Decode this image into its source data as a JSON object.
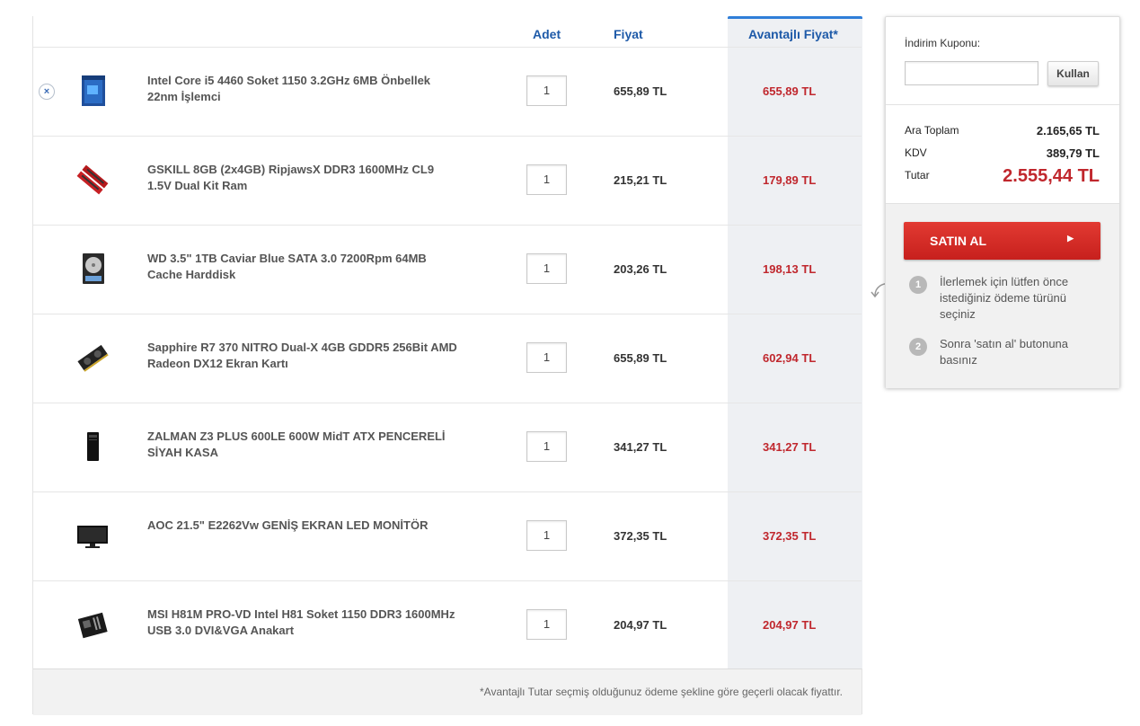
{
  "cart": {
    "headers": {
      "qty": "Adet",
      "price": "Fiyat",
      "adv_price": "Avantajlı Fiyat*"
    },
    "items": [
      {
        "name": "Intel Core i5 4460 Soket 1150 3.2GHz 6MB Önbellek 22nm İşlemci",
        "qty": "1",
        "price": "655,89 TL",
        "adv_price": "655,89 TL",
        "icon": "cpu-box-icon"
      },
      {
        "name": "GSKILL 8GB (2x4GB) RipjawsX DDR3 1600MHz CL9 1.5V Dual Kit Ram",
        "qty": "1",
        "price": "215,21 TL",
        "adv_price": "179,89 TL",
        "icon": "ram-icon"
      },
      {
        "name": "WD 3.5\" 1TB Caviar Blue SATA 3.0 7200Rpm 64MB Cache Harddisk",
        "qty": "1",
        "price": "203,26 TL",
        "adv_price": "198,13 TL",
        "icon": "harddisk-icon"
      },
      {
        "name": "Sapphire R7 370 NITRO Dual-X 4GB GDDR5 256Bit AMD Radeon DX12 Ekran Kartı",
        "qty": "1",
        "price": "655,89 TL",
        "adv_price": "602,94 TL",
        "icon": "gpu-icon"
      },
      {
        "name": "ZALMAN Z3 PLUS 600LE 600W MidT ATX PENCERELİ SİYAH KASA",
        "qty": "1",
        "price": "341,27 TL",
        "adv_price": "341,27 TL",
        "icon": "pc-case-icon"
      },
      {
        "name": "AOC 21.5\" E2262Vw GENİŞ EKRAN LED MONİTÖR",
        "qty": "1",
        "price": "372,35 TL",
        "adv_price": "372,35 TL",
        "icon": "monitor-icon"
      },
      {
        "name": "MSI H81M PRO-VD Intel H81 Soket 1150 DDR3 1600MHz USB 3.0 DVI&VGA Anakart",
        "qty": "1",
        "price": "204,97 TL",
        "adv_price": "204,97 TL",
        "icon": "motherboard-icon"
      }
    ],
    "remove_symbol": "×",
    "footnote": "*Avantajlı Tutar seçmiş olduğunuz ödeme şekline göre geçerli olacak fiyattır."
  },
  "summary": {
    "coupon_label": "İndirim Kuponu:",
    "coupon_value": "",
    "coupon_button": "Kullan",
    "subtotal_label": "Ara Toplam",
    "subtotal_value": "2.165,65 TL",
    "tax_label": "KDV",
    "tax_value": "389,79 TL",
    "total_label": "Tutar",
    "total_value": "2.555,44 TL",
    "buy_button": "SATIN AL",
    "buy_arrow": "▶",
    "steps": [
      {
        "num": "1",
        "text": "İlerlemek için lütfen önce istediğiniz ödeme türünü seçiniz"
      },
      {
        "num": "2",
        "text": "Sonra 'satın al' butonuna basınız"
      }
    ]
  },
  "colors": {
    "accent_blue": "#1e5aa8",
    "price_red": "#c0272d",
    "buy_red": "#d42a26"
  }
}
